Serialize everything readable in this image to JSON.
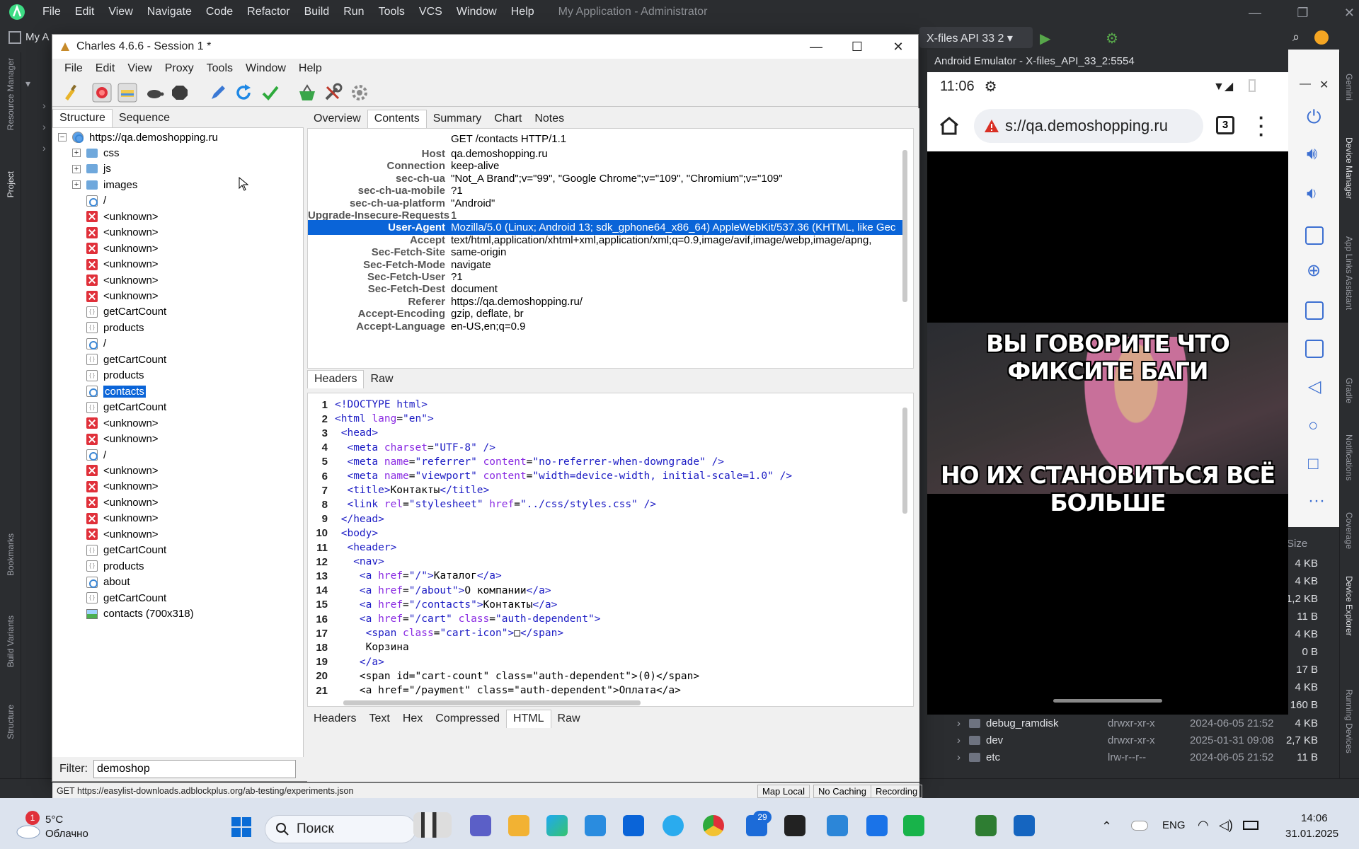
{
  "ide": {
    "menu": [
      "File",
      "Edit",
      "View",
      "Navigate",
      "Code",
      "Refactor",
      "Build",
      "Run",
      "Tools",
      "VCS",
      "Window",
      "Help"
    ],
    "window_title": "My Application - Administrator",
    "project_label": "My A",
    "device_selector": "X-files API 33 2",
    "left_tools": [
      "Resource Manager",
      "Project",
      "Bookmarks",
      "Build Variants",
      "Structure"
    ],
    "right_tools": [
      "Gemini",
      "Device Manager",
      "App Links Assistant",
      "Gradle",
      "Notifications",
      "Coverage",
      "Device Explorer",
      "Running Devices"
    ],
    "device_explorer": {
      "size_header": "Size",
      "sizes": [
        "4 KB",
        "4 KB",
        "1,2 KB",
        "11 B",
        "4 KB",
        "0 B",
        "17 B",
        "4 KB",
        "160 B"
      ],
      "rows": [
        {
          "name": "debug_ramdisk",
          "perm": "drwxr-xr-x",
          "date": "2024-06-05 21:52",
          "size": "4 KB"
        },
        {
          "name": "dev",
          "perm": "drwxr-xr-x",
          "date": "2025-01-31 09:08",
          "size": "2,7 KB"
        },
        {
          "name": "etc",
          "perm": "lrw-r--r--",
          "date": "2024-06-05 21:52",
          "size": "11 B"
        }
      ]
    }
  },
  "charles": {
    "title": "Charles 4.6.6 - Session 1 *",
    "menu": [
      "File",
      "Edit",
      "View",
      "Proxy",
      "Tools",
      "Window",
      "Help"
    ],
    "tabs": [
      "Structure",
      "Sequence"
    ],
    "tree": [
      {
        "label": "https://qa.demoshopping.ru",
        "icon": "globe",
        "level": 0,
        "expander": "−"
      },
      {
        "label": "css",
        "icon": "folder",
        "level": 1,
        "expander": "+"
      },
      {
        "label": "js",
        "icon": "folder",
        "level": 1,
        "expander": "+"
      },
      {
        "label": "images",
        "icon": "folder",
        "level": 1,
        "expander": "+"
      },
      {
        "label": "/",
        "icon": "page",
        "level": 1
      },
      {
        "label": "<unknown>",
        "icon": "error",
        "level": 1
      },
      {
        "label": "<unknown>",
        "icon": "error",
        "level": 1
      },
      {
        "label": "<unknown>",
        "icon": "error",
        "level": 1
      },
      {
        "label": "<unknown>",
        "icon": "error",
        "level": 1
      },
      {
        "label": "<unknown>",
        "icon": "error",
        "level": 1
      },
      {
        "label": "<unknown>",
        "icon": "error",
        "level": 1
      },
      {
        "label": "getCartCount",
        "icon": "json",
        "level": 1
      },
      {
        "label": "products",
        "icon": "json",
        "level": 1
      },
      {
        "label": "/",
        "icon": "page",
        "level": 1
      },
      {
        "label": "getCartCount",
        "icon": "json",
        "level": 1
      },
      {
        "label": "products",
        "icon": "json",
        "level": 1
      },
      {
        "label": "contacts",
        "icon": "page",
        "level": 1,
        "selected": true
      },
      {
        "label": "getCartCount",
        "icon": "json",
        "level": 1
      },
      {
        "label": "<unknown>",
        "icon": "error",
        "level": 1
      },
      {
        "label": "<unknown>",
        "icon": "error",
        "level": 1
      },
      {
        "label": "/",
        "icon": "page",
        "level": 1
      },
      {
        "label": "<unknown>",
        "icon": "error",
        "level": 1
      },
      {
        "label": "<unknown>",
        "icon": "error",
        "level": 1
      },
      {
        "label": "<unknown>",
        "icon": "error",
        "level": 1
      },
      {
        "label": "<unknown>",
        "icon": "error",
        "level": 1
      },
      {
        "label": "<unknown>",
        "icon": "error",
        "level": 1
      },
      {
        "label": "getCartCount",
        "icon": "json",
        "level": 1
      },
      {
        "label": "products",
        "icon": "json",
        "level": 1
      },
      {
        "label": "about",
        "icon": "page",
        "level": 1
      },
      {
        "label": "getCartCount",
        "icon": "json",
        "level": 1
      },
      {
        "label": "contacts (700x318)",
        "icon": "image",
        "level": 1
      }
    ],
    "filter_label": "Filter:",
    "filter_value": "demoshop",
    "detail_tabs": [
      "Overview",
      "Contents",
      "Summary",
      "Chart",
      "Notes"
    ],
    "active_detail_tab": "Contents",
    "request_line": "GET /contacts HTTP/1.1",
    "headers": [
      {
        "name": "Host",
        "value": "qa.demoshopping.ru"
      },
      {
        "name": "Connection",
        "value": "keep-alive"
      },
      {
        "name": "sec-ch-ua",
        "value": "\"Not_A Brand\";v=\"99\", \"Google Chrome\";v=\"109\", \"Chromium\";v=\"109\""
      },
      {
        "name": "sec-ch-ua-mobile",
        "value": "?1"
      },
      {
        "name": "sec-ch-ua-platform",
        "value": "\"Android\""
      },
      {
        "name": "Upgrade-Insecure-Requests",
        "value": "1"
      },
      {
        "name": "User-Agent",
        "value": "Mozilla/5.0 (Linux; Android 13; sdk_gphone64_x86_64) AppleWebKit/537.36 (KHTML, like Gec",
        "selected": true
      },
      {
        "name": "Accept",
        "value": "text/html,application/xhtml+xml,application/xml;q=0.9,image/avif,image/webp,image/apng,"
      },
      {
        "name": "Sec-Fetch-Site",
        "value": "same-origin"
      },
      {
        "name": "Sec-Fetch-Mode",
        "value": "navigate"
      },
      {
        "name": "Sec-Fetch-User",
        "value": "?1"
      },
      {
        "name": "Sec-Fetch-Dest",
        "value": "document"
      },
      {
        "name": "Referer",
        "value": "https://qa.demoshopping.ru/"
      },
      {
        "name": "Accept-Encoding",
        "value": "gzip, deflate, br"
      },
      {
        "name": "Accept-Language",
        "value": "en-US,en;q=0.9"
      }
    ],
    "request_tabs": [
      "Headers",
      "Raw"
    ],
    "code_lines": [
      {
        "n": "1",
        "html": "<span class=\"tg\">&lt;!DOCTYPE html&gt;</span>"
      },
      {
        "n": "2",
        "html": "<span class=\"tg\">&lt;html</span> <span class=\"at\">lang</span>=<span class=\"av\">\"en\"</span><span class=\"tg\">&gt;</span>"
      },
      {
        "n": "3",
        "html": " <span class=\"tg\">&lt;head&gt;</span>"
      },
      {
        "n": "4",
        "html": "  <span class=\"tg\">&lt;meta</span> <span class=\"at\">charset</span>=<span class=\"av\">\"UTF-8\"</span> <span class=\"tg\">/&gt;</span>"
      },
      {
        "n": "5",
        "html": "  <span class=\"tg\">&lt;meta</span> <span class=\"at\">name</span>=<span class=\"av\">\"referrer\"</span> <span class=\"at\">content</span>=<span class=\"av\">\"no-referrer-when-downgrade\"</span> <span class=\"tg\">/&gt;</span>"
      },
      {
        "n": "6",
        "html": "  <span class=\"tg\">&lt;meta</span> <span class=\"at\">name</span>=<span class=\"av\">\"viewport\"</span> <span class=\"at\">content</span>=<span class=\"av\">\"width=device-width, initial-scale=1.0\"</span> <span class=\"tg\">/&gt;</span>"
      },
      {
        "n": "7",
        "html": "  <span class=\"tg\">&lt;title&gt;</span>Контакты<span class=\"tg\">&lt;/title&gt;</span>"
      },
      {
        "n": "8",
        "html": "  <span class=\"tg\">&lt;link</span> <span class=\"at\">rel</span>=<span class=\"av\">\"stylesheet\"</span> <span class=\"at\">href</span>=<span class=\"av\">\"../css/styles.css\"</span> <span class=\"tg\">/&gt;</span>"
      },
      {
        "n": "9",
        "html": " <span class=\"tg\">&lt;/head&gt;</span>"
      },
      {
        "n": "10",
        "html": " <span class=\"tg\">&lt;body&gt;</span>"
      },
      {
        "n": "11",
        "html": "  <span class=\"tg\">&lt;header&gt;</span>"
      },
      {
        "n": "12",
        "html": "   <span class=\"tg\">&lt;nav&gt;</span>"
      },
      {
        "n": "13",
        "html": "    <span class=\"tg\">&lt;a</span> <span class=\"at\">href</span>=<span class=\"av\">\"/\"</span><span class=\"tg\">&gt;</span>Каталог<span class=\"tg\">&lt;/a&gt;</span>"
      },
      {
        "n": "14",
        "html": "    <span class=\"tg\">&lt;a</span> <span class=\"at\">href</span>=<span class=\"av\">\"/about\"</span><span class=\"tg\">&gt;</span>О компании<span class=\"tg\">&lt;/a&gt;</span>"
      },
      {
        "n": "15",
        "html": "    <span class=\"tg\">&lt;a</span> <span class=\"at\">href</span>=<span class=\"av\">\"/contacts\"</span><span class=\"tg\">&gt;</span>Контакты<span class=\"tg\">&lt;/a&gt;</span>"
      },
      {
        "n": "16",
        "html": "    <span class=\"tg\">&lt;a</span> <span class=\"at\">href</span>=<span class=\"av\">\"/cart\"</span> <span class=\"at\">class</span>=<span class=\"av\">\"auth-dependent\"</span><span class=\"tg\">&gt;</span>"
      },
      {
        "n": "17",
        "html": "     <span class=\"tg\">&lt;span</span> <span class=\"at\">class</span>=<span class=\"av\">\"cart-icon\"</span><span class=\"tg\">&gt;</span>□<span class=\"tg\">&lt;/span&gt;</span>"
      },
      {
        "n": "18",
        "html": "     Корзина"
      },
      {
        "n": "19",
        "html": "    <span class=\"tg\">&lt;/a&gt;</span>"
      },
      {
        "n": "20",
        "html": "    &lt;span id=\"cart-count\" class=\"auth-dependent\"&gt;(0)&lt;/span&gt;"
      },
      {
        "n": "21",
        "html": "    &lt;a href=\"/payment\" class=\"auth-dependent\"&gt;Оплата&lt;/a&gt;"
      }
    ],
    "response_tabs": [
      "Headers",
      "Text",
      "Hex",
      "Compressed",
      "HTML",
      "Raw"
    ],
    "active_response_tab": "HTML",
    "status_text": "GET https://easylist-downloads.adblockplus.org/ab-testing/experiments.json",
    "status_buttons": [
      "Map Local",
      "No Caching",
      "Recording"
    ]
  },
  "emulator": {
    "title": "Android Emulator - X-files_API_33_2:5554",
    "time": "11:06",
    "url": "s://qa.demoshopping.ru",
    "tab_count": "3",
    "meme_top": "ВЫ ГОВОРИТЕ ЧТО ФИКСИТЕ БАГИ",
    "meme_bottom": "НО ИХ СТАНОВИТЬСЯ ВСЁ БОЛЬШЕ"
  },
  "taskbar": {
    "weather_temp": "5°C",
    "weather_desc": "Облачно",
    "weather_badge": "1",
    "search_placeholder": "Поиск",
    "badge_count": "29",
    "lang": "ENG",
    "time": "14:06",
    "date": "31.01.2025"
  },
  "colors": {
    "selection": "#0a64d8",
    "record_red": "#e0303a",
    "ide_bg": "#2b2d30",
    "taskbar_bg": "#dce3ee"
  }
}
